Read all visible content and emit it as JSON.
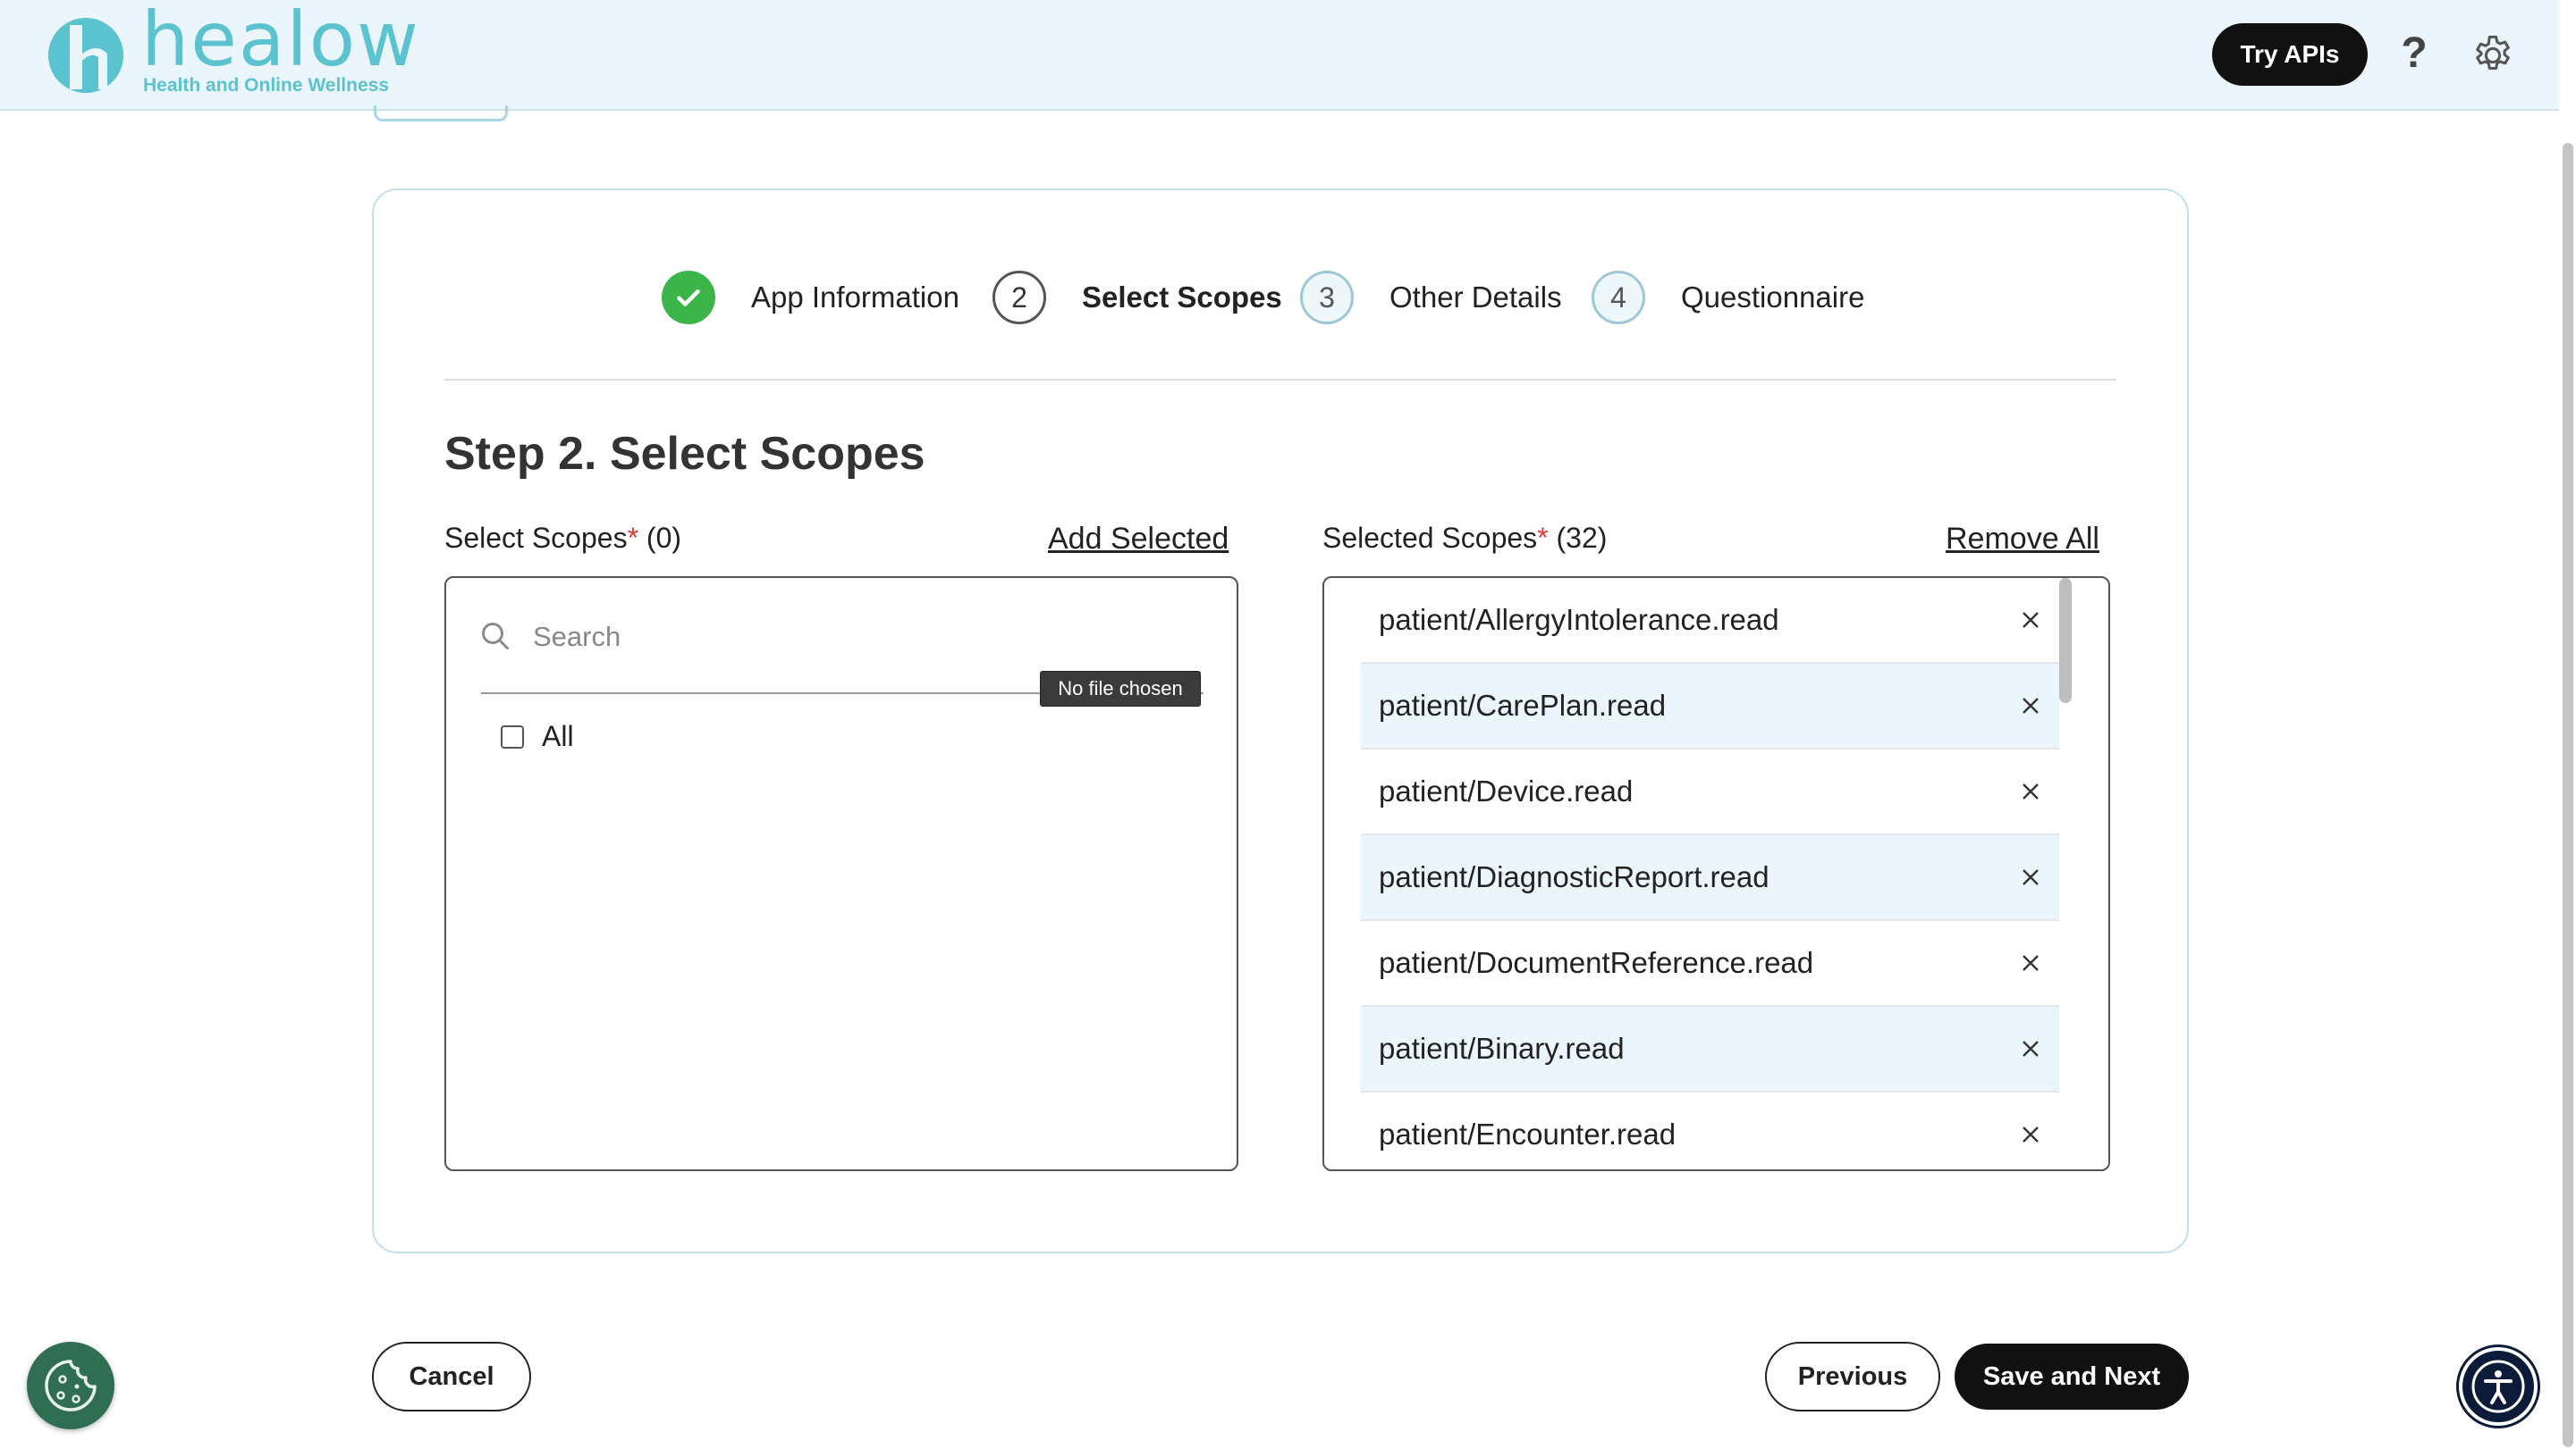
{
  "header": {
    "logo_word": "healow",
    "logo_tagline": "Health and Online Wellness",
    "try_apis_label": "Try APIs",
    "help_symbol": "?",
    "icons": [
      "help-icon",
      "gear-icon"
    ],
    "background_color": "#eaf6fb",
    "logo_color": "#5bc3d0"
  },
  "stepper": {
    "steps": [
      {
        "number": "1",
        "label": "App Information",
        "state": "completed"
      },
      {
        "number": "2",
        "label": "Select Scopes",
        "state": "active"
      },
      {
        "number": "3",
        "label": "Other Details",
        "state": "pending"
      },
      {
        "number": "4",
        "label": "Questionnaire",
        "state": "pending"
      }
    ],
    "completed_color": "#3bb54a"
  },
  "main": {
    "title": "Step 2. Select Scopes",
    "available": {
      "label": "Select Scopes",
      "required_mark": "*",
      "count": "(0)",
      "action": "Add Selected",
      "search_placeholder": "Search",
      "tooltip": "No file chosen",
      "all_label": "All"
    },
    "selected": {
      "label": "Selected Scopes",
      "required_mark": "*",
      "count": "(32)",
      "action": "Remove All",
      "items": [
        "patient/AllergyIntolerance.read",
        "patient/CarePlan.read",
        "patient/Device.read",
        "patient/DiagnosticReport.read",
        "patient/DocumentReference.read",
        "patient/Binary.read",
        "patient/Encounter.read"
      ],
      "alt_row_color": "#eaf6fb"
    }
  },
  "footer": {
    "cancel_label": "Cancel",
    "previous_label": "Previous",
    "save_next_label": "Save and Next",
    "icons": [
      "cookie-icon",
      "accessibility-icon"
    ]
  }
}
